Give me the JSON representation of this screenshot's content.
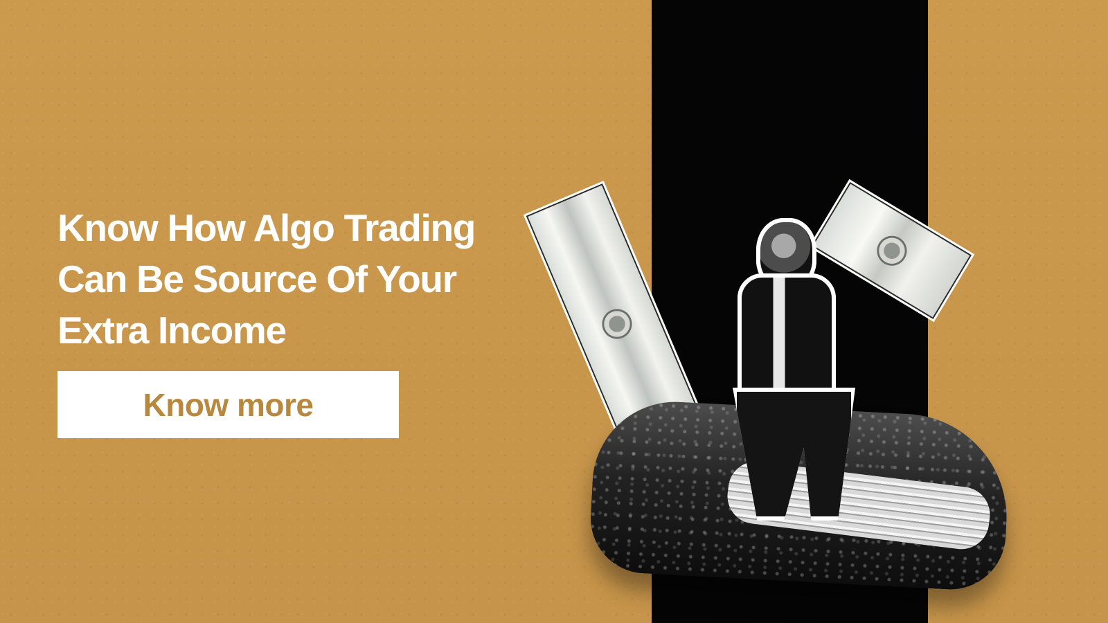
{
  "hero": {
    "headline_lines": [
      "Know How Algo Trading",
      "Can Be Source Of Your",
      "Extra Income"
    ],
    "cta_label": "Know more"
  },
  "colors": {
    "background": "#c8964a",
    "headline": "#ffffff",
    "button_background": "#ffffff",
    "button_text": "#b8883f",
    "dark_panel": "#050505"
  },
  "image": {
    "elements": [
      "wallet",
      "dollar-bill",
      "businessman"
    ]
  }
}
